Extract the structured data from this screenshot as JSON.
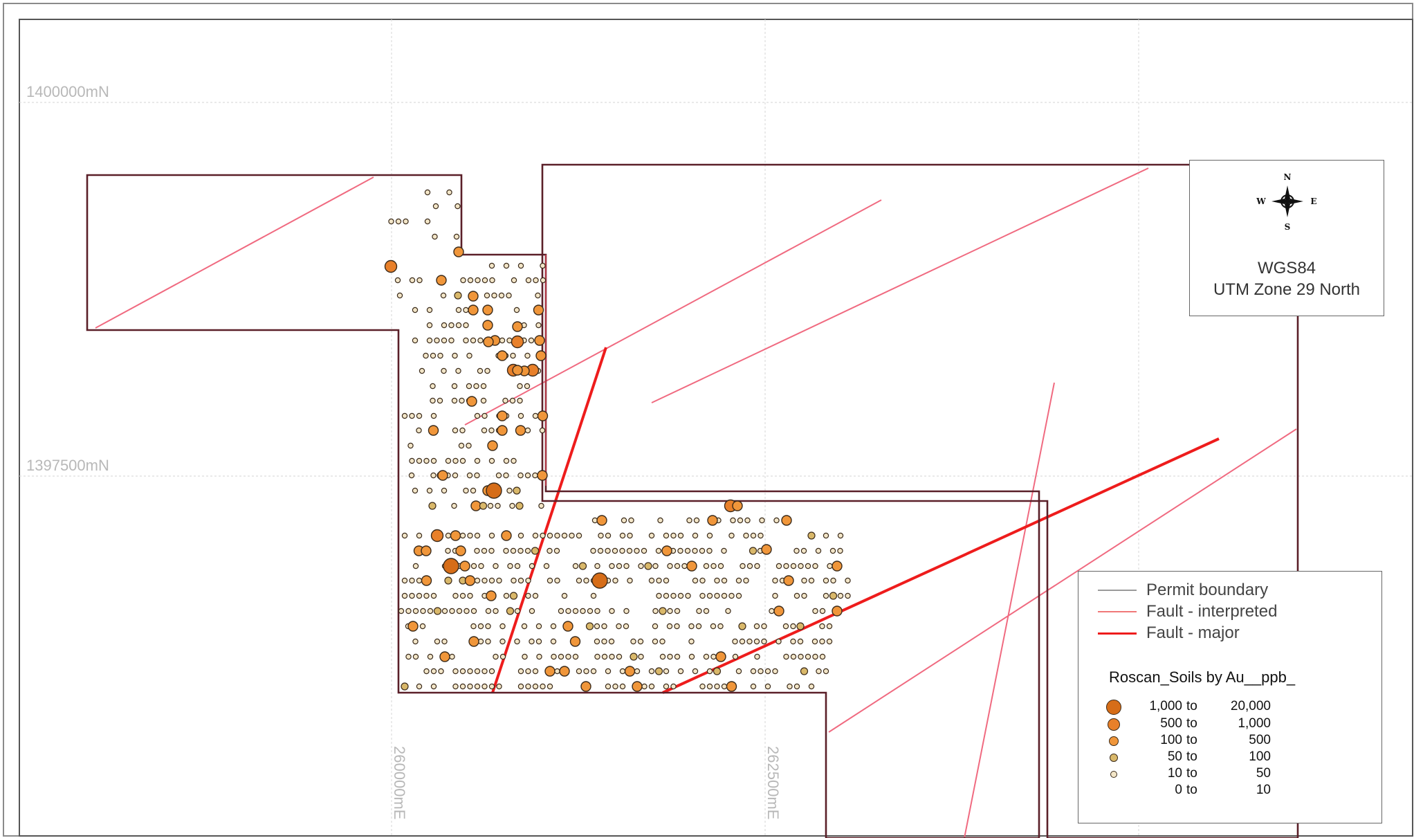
{
  "map": {
    "grid_labels": {
      "northing_1": "1400000mN",
      "northing_2": "1397500mN",
      "easting_1": "260000mE",
      "easting_2": "262500mE"
    },
    "crs": {
      "datum": "WGS84",
      "projection": "UTM Zone 29 North"
    },
    "compass": {
      "n": "N",
      "s": "S",
      "e": "E",
      "w": "W"
    },
    "legend": {
      "line_items": [
        {
          "label": "Permit boundary",
          "color": "#9a9a9a"
        },
        {
          "label": "Fault - interpreted",
          "color": "#f07878"
        },
        {
          "label": "Fault - major",
          "color": "#ee1c1c"
        }
      ],
      "title": "Roscan_Soils by Au__ppb_",
      "classes": [
        {
          "low": "1,000",
          "to": "to",
          "high": "20,000",
          "color": "#d66d18"
        },
        {
          "low": "500",
          "to": "to",
          "high": "1,000",
          "color": "#e8802a"
        },
        {
          "low": "100",
          "to": "to",
          "high": "500",
          "color": "#f0963a"
        },
        {
          "low": "50",
          "to": "to",
          "high": "100",
          "color": "#d9b86a"
        },
        {
          "low": "10",
          "to": "to",
          "high": "50",
          "color": "#f3e6c8"
        },
        {
          "low": "0",
          "to": "to",
          "high": "10",
          "color": "#ffffff"
        }
      ]
    },
    "colors": {
      "permit_boundary": "#5a1f28",
      "fault_interpreted": "#f06a80",
      "fault_major": "#ee1c1c",
      "sample_outline": "#3a2a1a"
    }
  }
}
